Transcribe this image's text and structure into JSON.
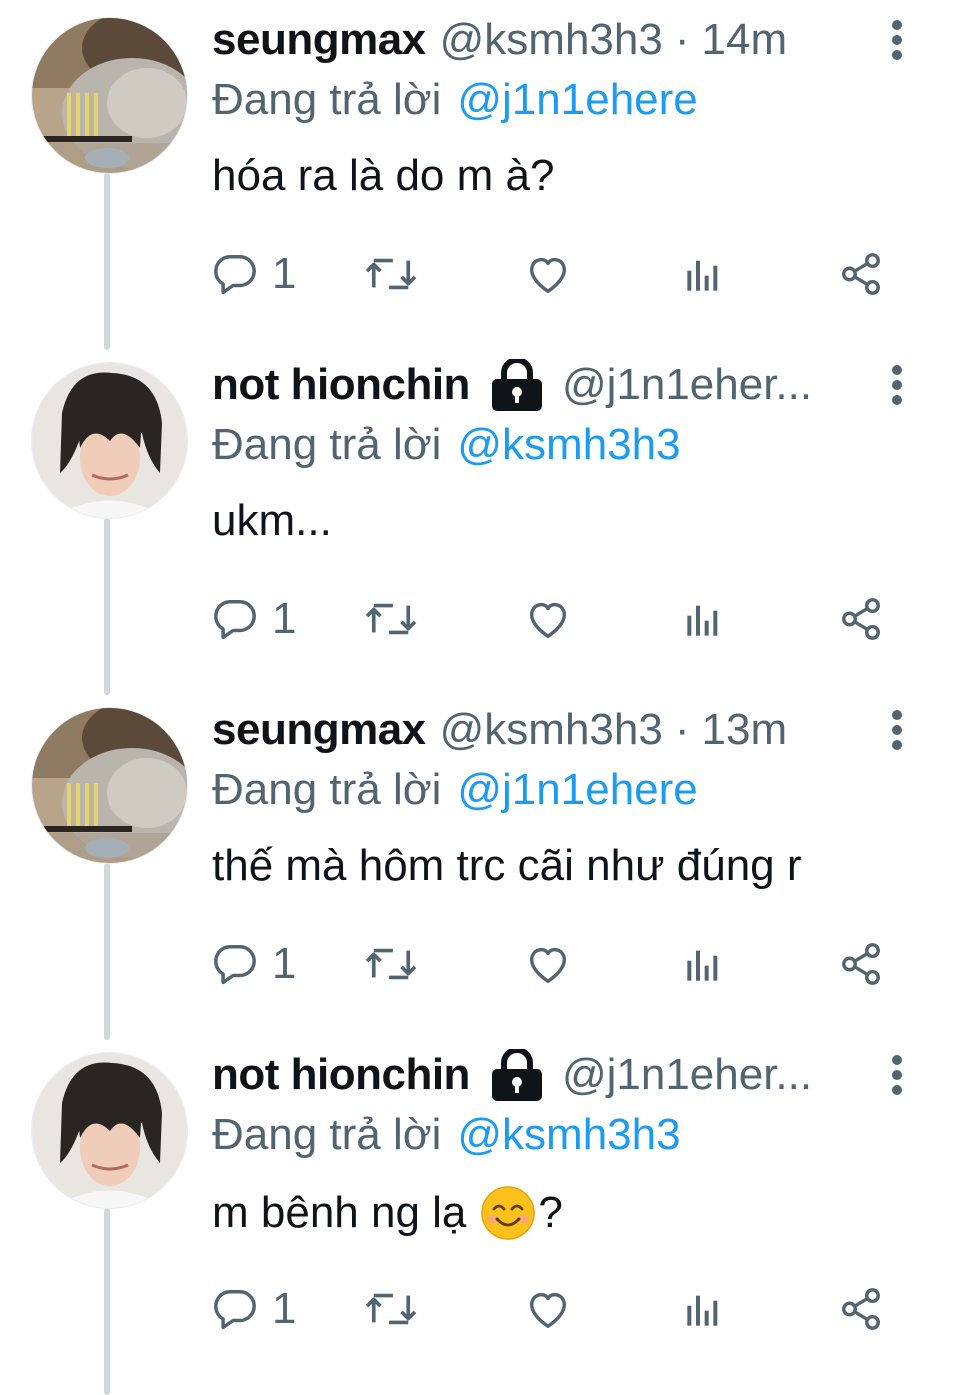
{
  "thread": {
    "tweets": [
      {
        "avatar": "pillow-photo",
        "name": "seungmax",
        "handle": "@ksmh3h3",
        "time": "14m",
        "protected": false,
        "reply_prefix": "Đang trả lời",
        "reply_to": "@j1n1ehere",
        "text": "hóa ra là do m à?",
        "text_suffix": "",
        "emoji": "",
        "reply_count": "1"
      },
      {
        "avatar": "person-photo",
        "name": "not hionchin",
        "handle": "@j1n1eher...",
        "time": "",
        "protected": true,
        "reply_prefix": "Đang trả lời",
        "reply_to": "@ksmh3h3",
        "text": "ukm...",
        "text_suffix": "",
        "emoji": "",
        "reply_count": "1"
      },
      {
        "avatar": "pillow-photo",
        "name": "seungmax",
        "handle": "@ksmh3h3",
        "time": "13m",
        "protected": false,
        "reply_prefix": "Đang trả lời",
        "reply_to": "@j1n1ehere",
        "text": "thế mà hôm trc cãi như đúng r",
        "text_suffix": "",
        "emoji": "",
        "reply_count": "1"
      },
      {
        "avatar": "person-photo",
        "name": "not hionchin",
        "handle": "@j1n1eher...",
        "time": "",
        "protected": true,
        "reply_prefix": "Đang trả lời",
        "reply_to": "@ksmh3h3",
        "text": "m bênh ng lạ",
        "text_suffix": "?",
        "emoji": "smiling-face-icon",
        "reply_count": "1"
      }
    ]
  },
  "time_separator": "·",
  "colors": {
    "text": "#0f1419",
    "secondary": "#536471",
    "accent": "#1d9bf0",
    "thread_line": "#cfd9de"
  },
  "icons": {
    "reply": "reply-icon",
    "retweet": "retweet-icon",
    "like": "heart-icon",
    "views": "views-chart-icon",
    "share": "share-icon",
    "more": "more-vertical-icon",
    "protected": "lock-icon"
  }
}
